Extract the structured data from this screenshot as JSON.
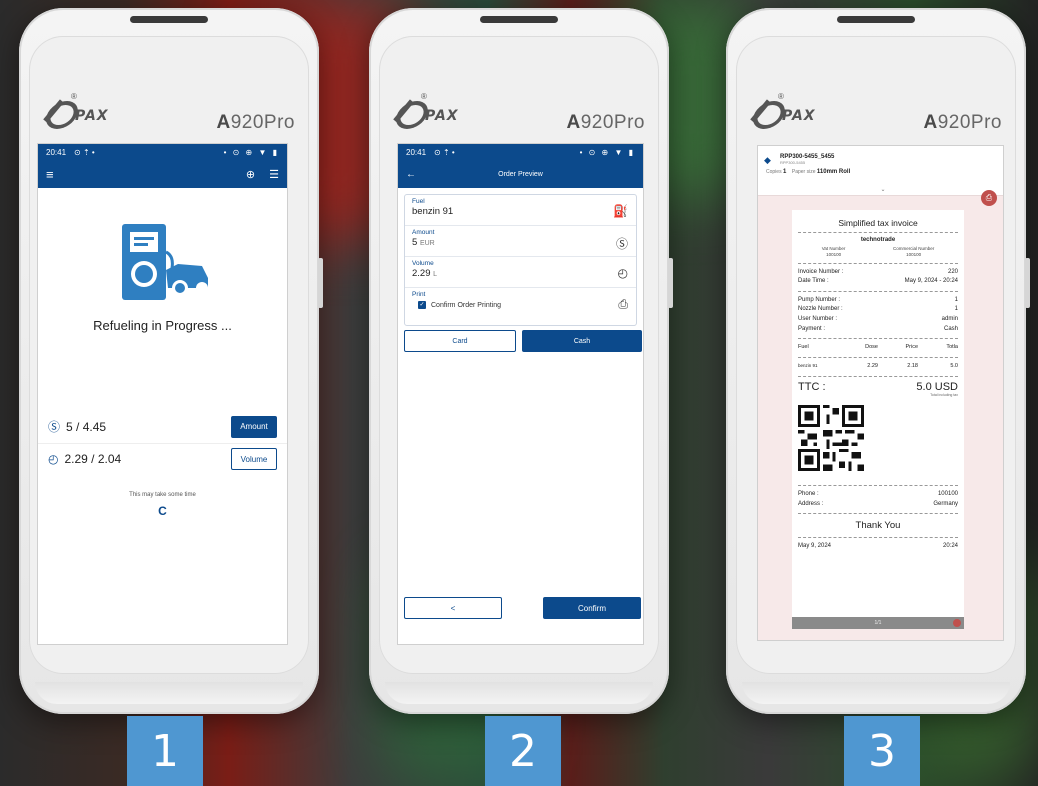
{
  "brand": {
    "logo_text": "PAX",
    "model_prefix": "A",
    "model_suffix": "920Pro"
  },
  "screen1": {
    "status": {
      "time": "20:41",
      "icons_left": "⊙ ⇡ •",
      "icons_right": "• ⊙ ⊕ ▼ ▮"
    },
    "title": "Refueling in Progress ...",
    "amount": {
      "value": "5 / 4.45",
      "button": "Amount"
    },
    "volume": {
      "value": "2.29 / 2.04",
      "button": "Volume"
    },
    "wait_text": "This may take some time",
    "spinner": "C"
  },
  "screen2": {
    "status": {
      "time": "20:41",
      "icons_left": "⊙ ⇡ •",
      "icons_right": "• ⊙ ⊕ ▼ ▮"
    },
    "title": "Order Preview",
    "fuel": {
      "label": "Fuel",
      "value": "benzin 91"
    },
    "amount": {
      "label": "Amount",
      "value": "5",
      "unit": "EUR"
    },
    "volume": {
      "label": "Volume",
      "value": "2.29",
      "unit": "L"
    },
    "print": {
      "label": "Print",
      "checkbox_label": "Confirm Order Printing"
    },
    "card_button": "Card",
    "cash_button": "Cash",
    "back_button": "<",
    "confirm_button": "Confirm"
  },
  "screen3": {
    "printer_name": "RPP300-5455_5455",
    "printer_sub": "RPP300-5455",
    "copies_label": "Copies",
    "copies_value": "1",
    "paper_label": "Paper size",
    "paper_value": "110mm Roll",
    "receipt": {
      "title": "Simplified tax invoice",
      "company": "technotrade",
      "vat_label": "Vat Number",
      "vat_value": "100100",
      "commercial_label": "Commercial Number",
      "commercial_value": "100100",
      "invoice_label": "Invoice Number :",
      "invoice_value": "220",
      "datetime_label": "Date Time :",
      "datetime_value": "May 9, 2024 - 20:24",
      "pump_label": "Pump Number :",
      "pump_value": "1",
      "nozzle_label": "Nozzle Number :",
      "nozzle_value": "1",
      "user_label": "User Number :",
      "user_value": "admin",
      "payment_label": "Payment :",
      "payment_value": "Cash",
      "table_headers": [
        "Fuel",
        "Dose",
        "Price",
        "Totla"
      ],
      "table_row": [
        "benzin 91",
        "2.29",
        "2.18",
        "5.0"
      ],
      "ttc_label": "TTC :",
      "ttc_value": "5.0 USD",
      "ttc_note": "Total including tax",
      "phone_label": "Phone :",
      "phone_value": "100100",
      "address_label": "Address :",
      "address_value": "Germany",
      "thanks": "Thank You",
      "footer_date": "May 9, 2024",
      "footer_time": "20:24"
    },
    "pager": "1/1"
  },
  "steps": [
    "1",
    "2",
    "3"
  ],
  "colors": {
    "primary": "#0c4a8c",
    "step": "#4f97d1",
    "accent": "#c0504d"
  }
}
